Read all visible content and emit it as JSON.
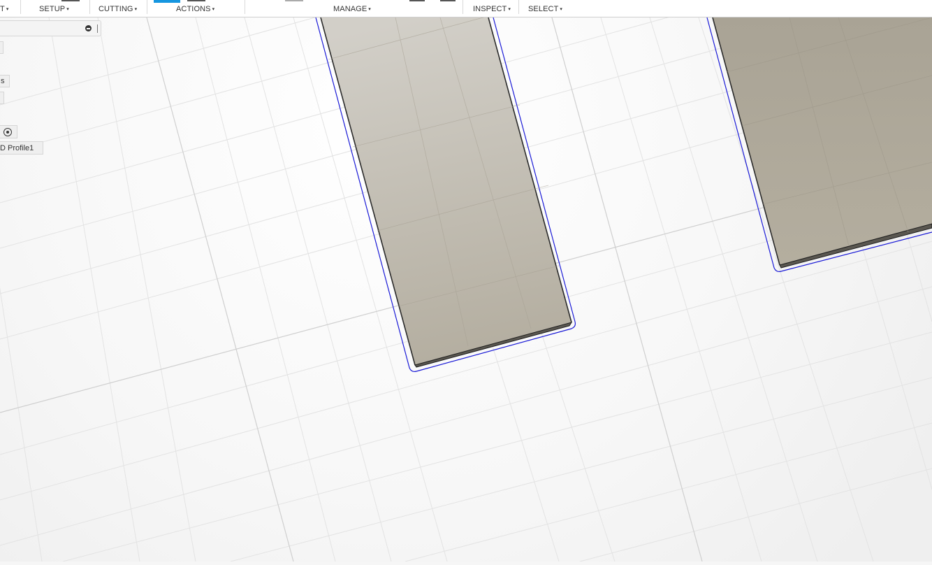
{
  "toolbar": {
    "menus": [
      {
        "label": "T",
        "truncated": true
      },
      {
        "label": "SETUP"
      },
      {
        "label": "CUTTING"
      },
      {
        "label": "ACTIONS"
      },
      {
        "label": "MANAGE"
      },
      {
        "label": "INSPECT"
      },
      {
        "label": "SELECT"
      }
    ],
    "caret": "▾",
    "accent_color": "#1696e0"
  },
  "browser": {
    "row_1_fragment": "s",
    "profile_label": "D Profile1"
  },
  "colors": {
    "canvas_bg": "#f6f6f6",
    "grid": "#dcdcdc",
    "body_face": "#bab4aa",
    "toolpath": "#1a1ad6"
  }
}
